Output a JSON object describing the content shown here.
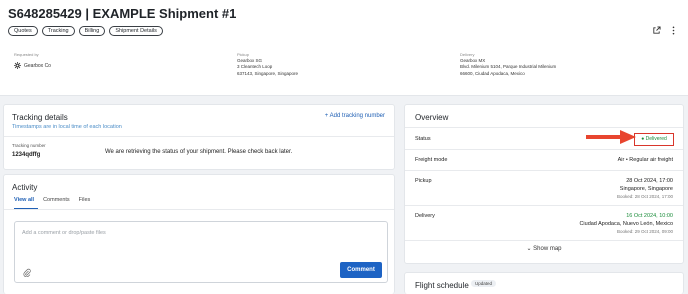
{
  "header": {
    "title": "S648285429 | EXAMPLE Shipment #1",
    "tabs": [
      "Quotes",
      "Tracking",
      "Billing",
      "Shipment Details"
    ]
  },
  "parties": {
    "requested_by": {
      "label": "Requested by",
      "name": "Gearbox Co"
    },
    "pickup": {
      "label": "Pickup",
      "lines": [
        "Gearbox SG",
        "3 Cleantech Loop",
        "637143, Singapore, Singapore"
      ]
    },
    "delivery": {
      "label": "Delivery",
      "lines": [
        "Gearbox MX",
        "Blvd. Milenium 5104, Parque Industrial Milenium",
        "66600, Ciudad Apodaca, Mexico"
      ]
    }
  },
  "tracking": {
    "title": "Tracking details",
    "subtitle": "Timestamps are in local time of each location",
    "add_label": "+ Add tracking number",
    "number_label": "Tracking number",
    "number_value": "1234qdffg",
    "message": "We are retrieving the status of your shipment. Please check back later."
  },
  "activity": {
    "title": "Activity",
    "tabs": [
      "View all",
      "Comments",
      "Files"
    ],
    "placeholder": "Add a comment or drop/paste files",
    "comment_button": "Comment"
  },
  "overview": {
    "title": "Overview",
    "status_label": "Status",
    "status_value": "● Delivered",
    "freight_label": "Freight mode",
    "freight_value": "Air • Regular air freight",
    "pickup_label": "Pickup",
    "pickup_date": "28 Oct 2024, 17:00",
    "pickup_place": "Singapore, Singapore",
    "pickup_booked": "Booked: 28 Oct 2024, 17:00",
    "delivery_label": "Delivery",
    "delivery_date": "16 Oct 2024, 10:00",
    "delivery_place": "Ciudad Apodaca, Nuevo León, Mexico",
    "delivery_booked": "Booked: 29 Oct 2024, 09:00",
    "show_map": "⌄  Show map"
  },
  "flight": {
    "title": "Flight schedule",
    "badge": "Updated"
  },
  "colors": {
    "accent": "#1d63c4",
    "delivered": "#1a8c3a",
    "highlight": "#d9362b"
  }
}
